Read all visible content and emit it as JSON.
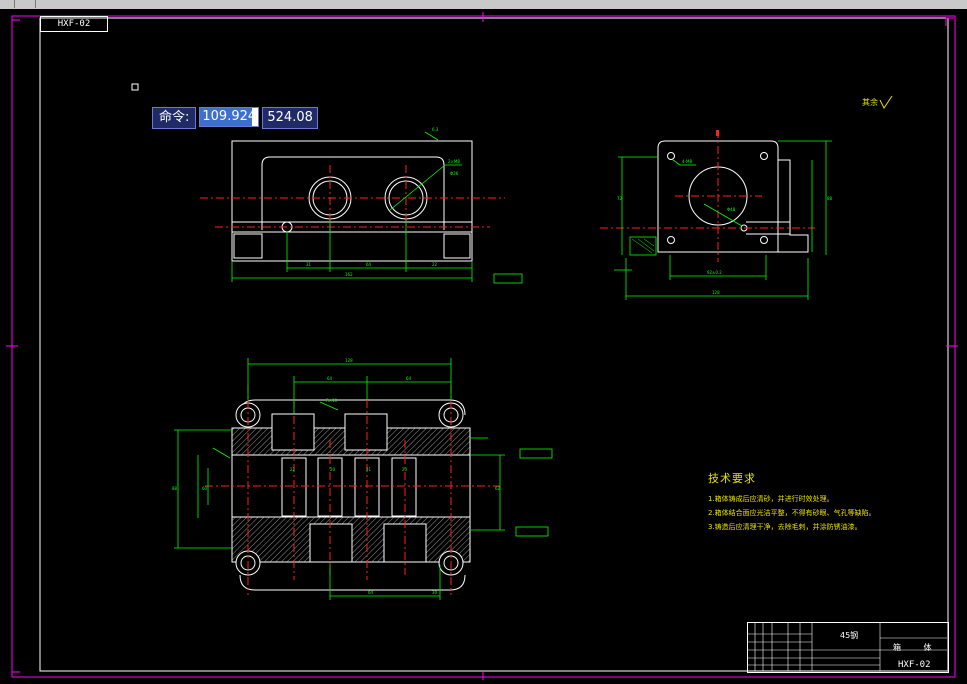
{
  "window": {
    "drawing_tab": "HXF-02"
  },
  "command_line": {
    "label": "命令:",
    "x_value": "109.924",
    "y_value": "524.08"
  },
  "tech_requirements": {
    "heading": "技术要求",
    "items": [
      "1.箱体铸成后应清砂，并进行时效处理。",
      "2.箱体结合面应光洁平整，不得有砂眼、气孔等缺陷。",
      "3.铸造后应清理干净，去除毛刺，并涂防锈油漆。"
    ]
  },
  "title_block": {
    "material": "45钢",
    "part_name": "箱 体",
    "drawing_code": "HXF-02"
  },
  "roughness_note": "其余",
  "colors": {
    "border": "#ff00ff",
    "frame": "#ffffff",
    "centerline": "#ff2020",
    "dimension": "#00ff00",
    "text": "#e8e000",
    "command_bg": "#1f2a66",
    "selection": "#3d6fcf"
  }
}
